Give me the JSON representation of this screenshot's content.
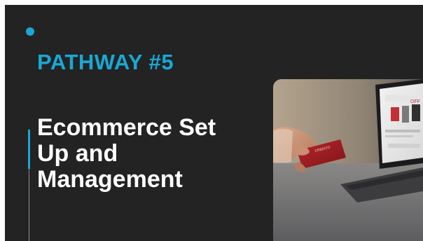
{
  "slide": {
    "kicker": "PATHWAY #5",
    "title_lines": [
      "Ecommerce Set",
      "Up and",
      "Management"
    ]
  },
  "colors": {
    "background": "#232323",
    "accent": "#19a8d4",
    "title": "#ffffff"
  },
  "photo": {
    "subject": "hand holding credit card in front of laptop showing online store"
  }
}
